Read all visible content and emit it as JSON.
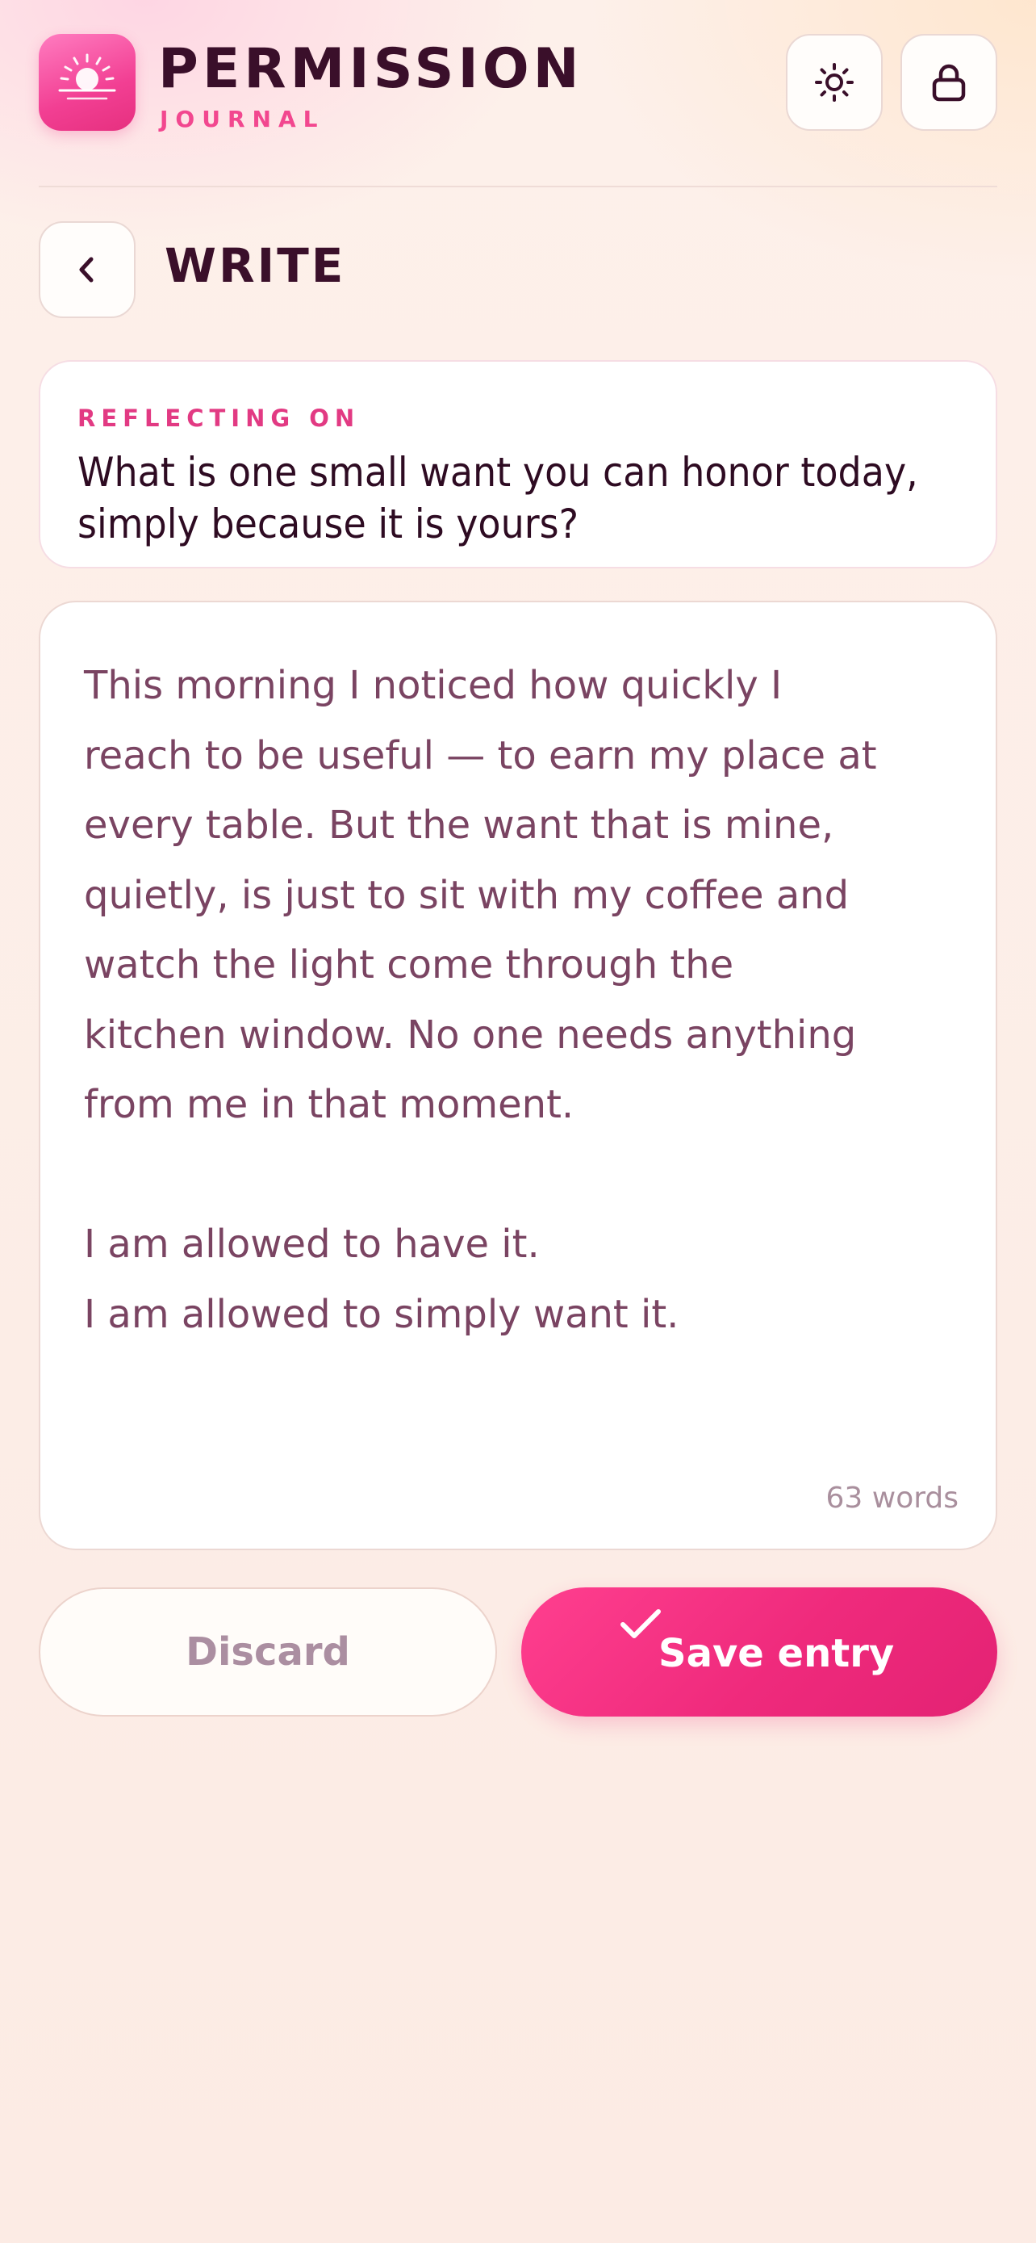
{
  "app": {
    "title": "PERMISSION",
    "subtitle": "JOURNAL",
    "logo_icon": "sunrise-icon",
    "accent": "#f2478f"
  },
  "header": {
    "theme_icon": "sun-icon",
    "lock_icon": "lock-icon"
  },
  "page": {
    "back_icon": "chevron-left-icon",
    "title": "WRITE"
  },
  "prompt": {
    "label": "REFLECTING ON",
    "text": "What is one small want you can honor today, simply because it is yours?"
  },
  "editor": {
    "value": "This morning I noticed how quickly I\nreach to be useful — to earn my place at\nevery table. But the want that is mine,\nquietly, is just to sit with my coffee and\nwatch the light come through the\nkitchen window. No one needs anything\nfrom me in that moment.\n\nI am allowed to have it.\nI am allowed to simply want it.",
    "word_count": "63 words"
  },
  "actions": {
    "discard_label": "Discard",
    "save_label": "Save entry",
    "save_icon": "check-icon",
    "save_color": "#ef2a7c"
  }
}
